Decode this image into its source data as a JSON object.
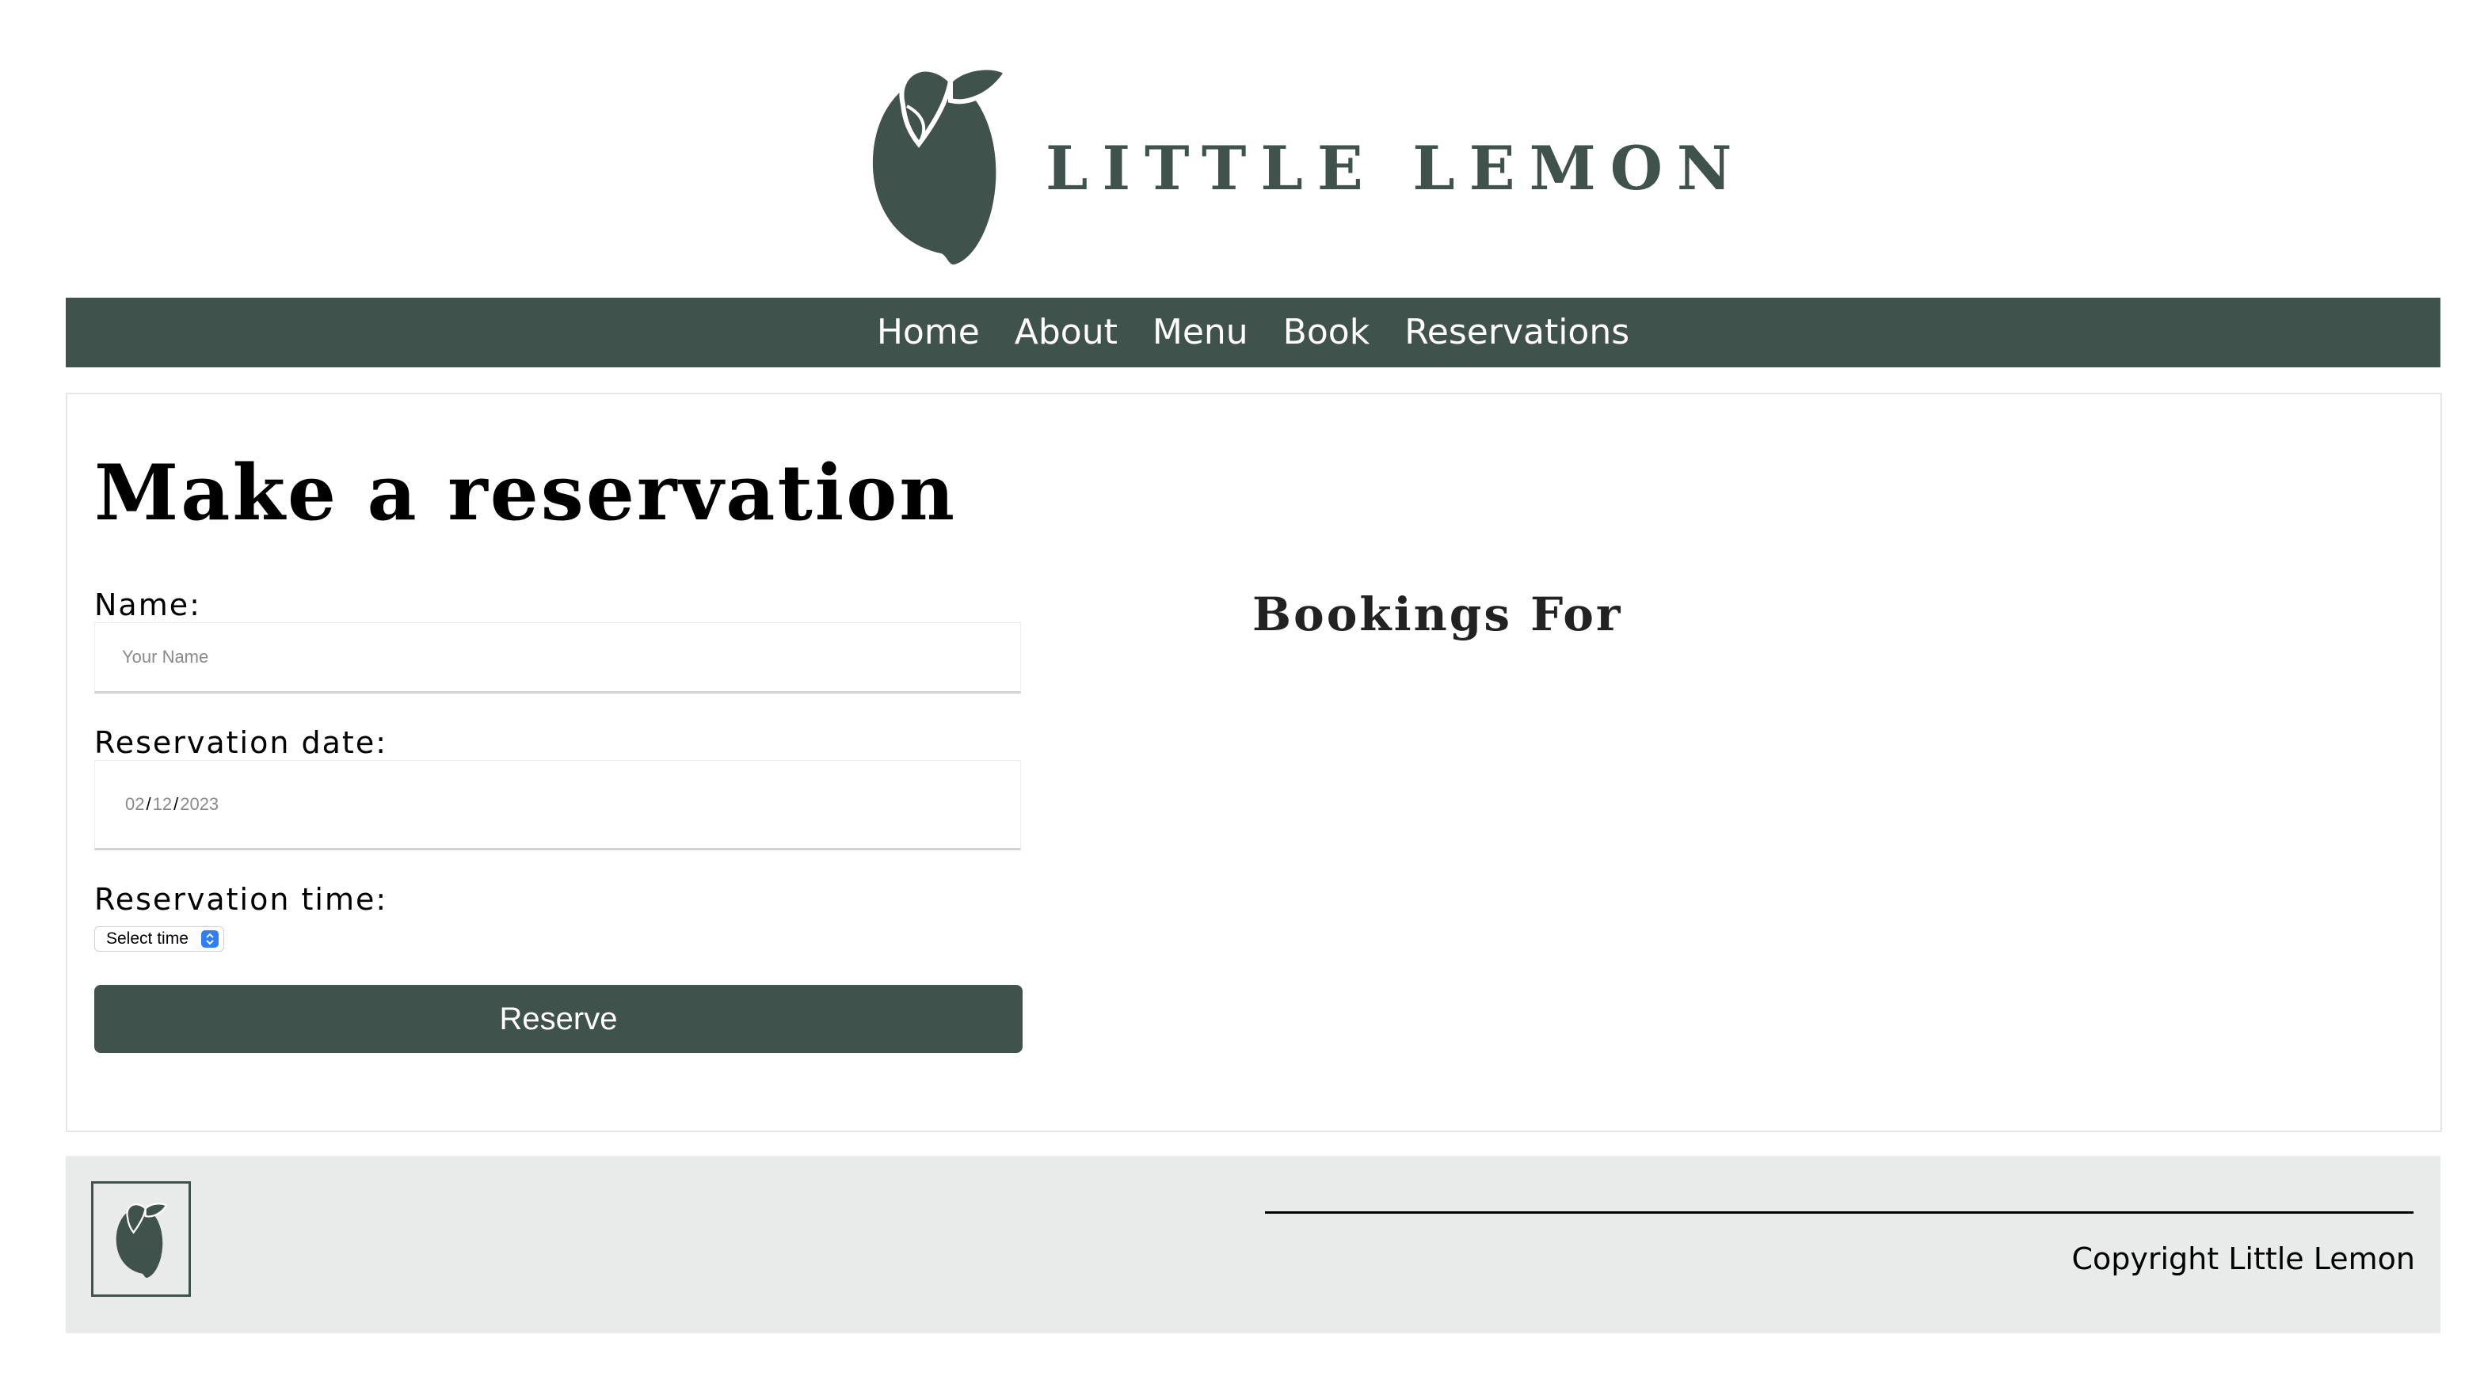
{
  "brand": {
    "name": "LITTLE LEMON",
    "accent_color": "#40524c",
    "logo_icon": "lemon-icon"
  },
  "nav": {
    "items": [
      {
        "label": "Home"
      },
      {
        "label": "About"
      },
      {
        "label": "Menu"
      },
      {
        "label": "Book"
      },
      {
        "label": "Reservations"
      }
    ]
  },
  "reservation": {
    "title": "Make a reservation",
    "name_label": "Name:",
    "name_placeholder": "Your Name",
    "date_label": "Reservation date:",
    "date_value": {
      "month": "02",
      "day": "12",
      "year": "2023",
      "separator": "/"
    },
    "time_label": "Reservation time:",
    "time_select_value": "Select time",
    "submit_label": "Reserve"
  },
  "bookings": {
    "title": "Bookings For"
  },
  "footer": {
    "copyright": "Copyright Little Lemon",
    "logo_icon": "lemon-icon"
  }
}
